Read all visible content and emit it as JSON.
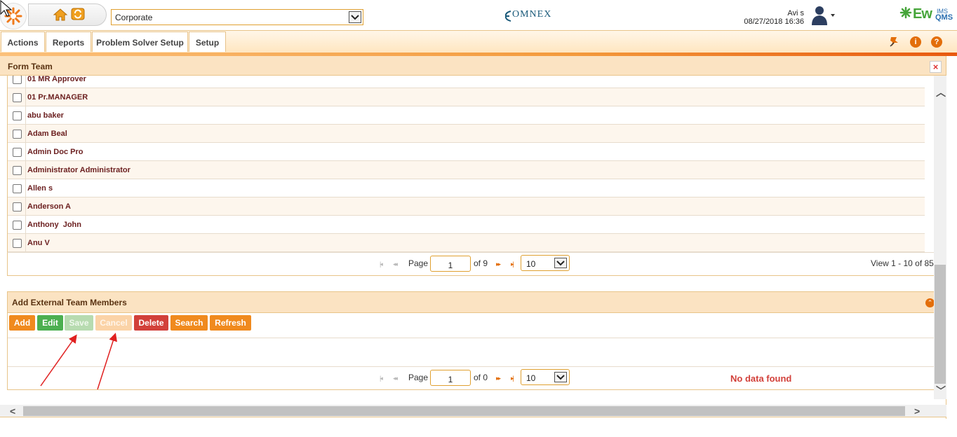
{
  "header": {
    "company_select": "Corporate",
    "omnex_logo_text": "OMNEX",
    "user_name": "Avi s",
    "datetime": "08/27/2018 16:36",
    "ewqims_text_main": "Ew",
    "ewqims_text_top": "IMS",
    "ewqims_text_bottom": "QMS"
  },
  "menu": {
    "tabs": [
      {
        "label": "Actions"
      },
      {
        "label": "Reports"
      },
      {
        "label": "Problem Solver Setup"
      },
      {
        "label": "Setup"
      }
    ],
    "right_icons": [
      "pin-icon",
      "info-icon",
      "help-icon"
    ]
  },
  "form_team": {
    "title": "Form Team",
    "close_label": "×",
    "members": [
      "01 MR Approver",
      "01 Pr.MANAGER",
      "abu baker",
      "Adam Beal",
      "Admin Doc Pro",
      "Administrator Administrator",
      "Allen s",
      "Anderson A",
      "Anthony  John",
      "Anu V"
    ],
    "pager": {
      "page_label": "Page",
      "page_value": "1",
      "of_label": "of 9",
      "page_size": "10",
      "view_text": "View 1 - 10 of 85"
    }
  },
  "external": {
    "title": "Add External Team Members",
    "buttons": {
      "add": "Add",
      "edit": "Edit",
      "save": "Save",
      "cancel": "Cancel",
      "delete": "Delete",
      "search": "Search",
      "refresh": "Refresh"
    },
    "pager": {
      "page_label": "Page",
      "page_value": "1",
      "of_label": "of 0",
      "page_size": "10"
    },
    "no_data_text": "No data found"
  },
  "colors": {
    "accent_orange": "#f08a1e",
    "panel_header": "#fbe3c2",
    "name_text": "#6b1f1f",
    "annotation_red": "#e02020"
  }
}
